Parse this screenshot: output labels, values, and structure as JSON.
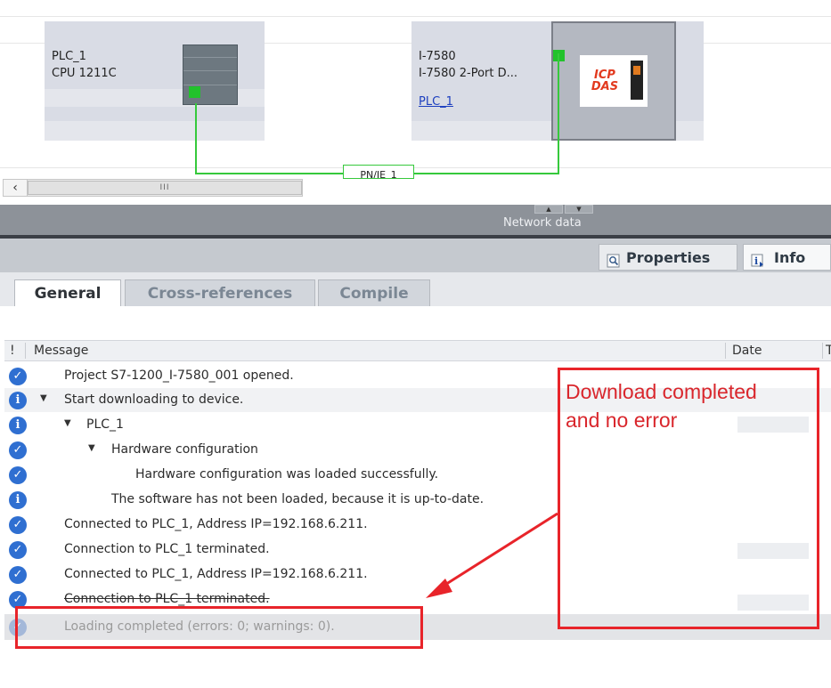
{
  "network": {
    "devices": [
      {
        "name": "PLC_1",
        "type": "CPU 1211C"
      },
      {
        "name": "I-7580",
        "type": "I-7580 2-Port D...",
        "link": "PLC_1",
        "logo": "ICP DAS"
      }
    ],
    "subnet_label": "PN/IE_1",
    "scrollbar_grip": "III"
  },
  "splitter": {
    "label": "Network data",
    "handle_up": "▲",
    "handle_down": "▼"
  },
  "inspector_tabs": {
    "properties": "Properties",
    "info": "Info"
  },
  "sub_tabs": {
    "general": "General",
    "cross_references": "Cross-references",
    "compile": "Compile"
  },
  "table": {
    "headers": {
      "flag": "!",
      "message": "Message",
      "date": "Date",
      "extra": "T"
    },
    "rows": [
      {
        "icon": "check-icon",
        "message": "Project S7-1200_I-7580_001 opened."
      },
      {
        "icon": "info-icon",
        "message": "Start downloading to device."
      },
      {
        "icon": "info-icon",
        "message": "PLC_1"
      },
      {
        "icon": "check-icon",
        "message": "Hardware configuration"
      },
      {
        "icon": "check-icon",
        "message": "Hardware configuration was loaded successfully."
      },
      {
        "icon": "info-icon",
        "message": "The software has not been loaded, because it is up-to-date."
      },
      {
        "icon": "check-icon",
        "message": "Connected to PLC_1, Address IP=192.168.6.211."
      },
      {
        "icon": "check-icon",
        "message": "Connection to PLC_1 terminated."
      },
      {
        "icon": "check-icon",
        "message": "Connected to PLC_1, Address IP=192.168.6.211."
      },
      {
        "icon": "check-icon",
        "message": "Connection to PLC_1 terminated."
      },
      {
        "icon": "check-icon",
        "message": "Loading completed (errors: 0; warnings: 0)."
      }
    ]
  },
  "annotation": {
    "text_line1": "Download completed",
    "text_line2": "and no error",
    "color": "#e8242a"
  }
}
